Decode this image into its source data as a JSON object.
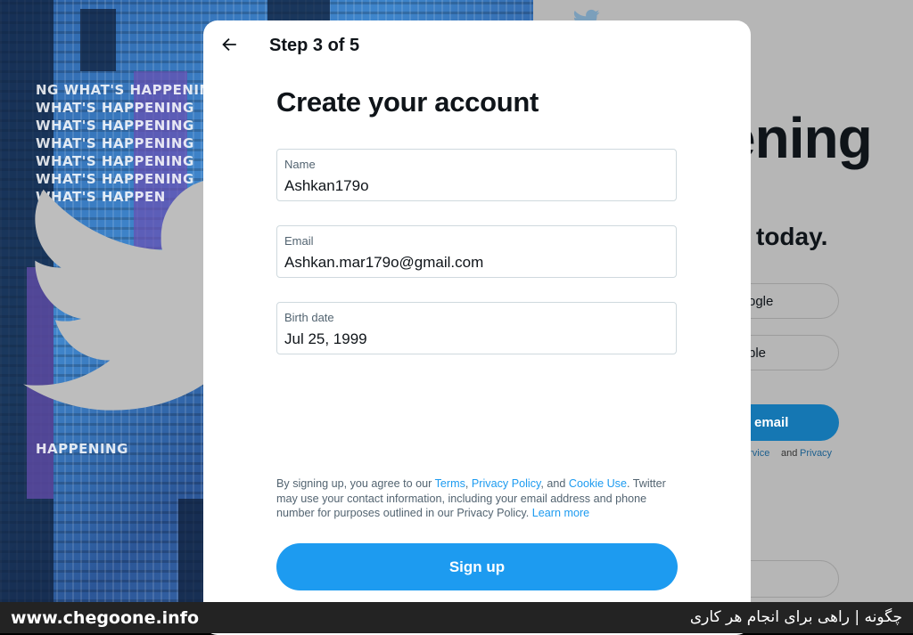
{
  "background": {
    "left_words": [
      "NG WHAT'S HAPPENING",
      "WHAT'S HAPPENING",
      "WHAT'S HAPPENING",
      "WHAT'S HAPPENING",
      "WHAT'S HAPPENING",
      "WHAT'S HAPPENING",
      "WHAT'S HAPPEN",
      "HAPPENING"
    ],
    "right": {
      "headline_fragment": "ening",
      "subhead_fragment": "today.",
      "google_fragment": "ogle",
      "apple_fragment": "ple",
      "email_fragment": "r email",
      "terms_fragment": "ervice",
      "terms_and": "and",
      "privacy_fragment": "Privacy",
      "dot": "·"
    }
  },
  "modal": {
    "step": "Step 3 of 5",
    "title": "Create your account",
    "fields": [
      {
        "label": "Name",
        "value": "Ashkan179o"
      },
      {
        "label": "Email",
        "value": "Ashkan.mar179o@gmail.com"
      },
      {
        "label": "Birth date",
        "value": "Jul 25, 1999"
      }
    ],
    "legal": {
      "prefix": "By signing up, you agree to our ",
      "terms": "Terms",
      "comma": ", ",
      "privacy": "Privacy Policy",
      "and": ", and ",
      "cookie": "Cookie Use",
      "rest": ". Twitter may use your contact information, including your email address and phone number for purposes outlined in our Privacy Policy. ",
      "learn_more": "Learn more"
    },
    "signup_label": "Sign up"
  },
  "footer": {
    "site": "www.chegoone.info",
    "tagline": "چگونه | راهی برای انجام هر کاری"
  },
  "colors": {
    "accent": "#1d9bf0",
    "text": "#0f1419",
    "muted": "#536471",
    "border": "#cfd9de"
  },
  "icons": {
    "back": "arrow-left-icon",
    "bird": "twitter-bird-icon"
  }
}
